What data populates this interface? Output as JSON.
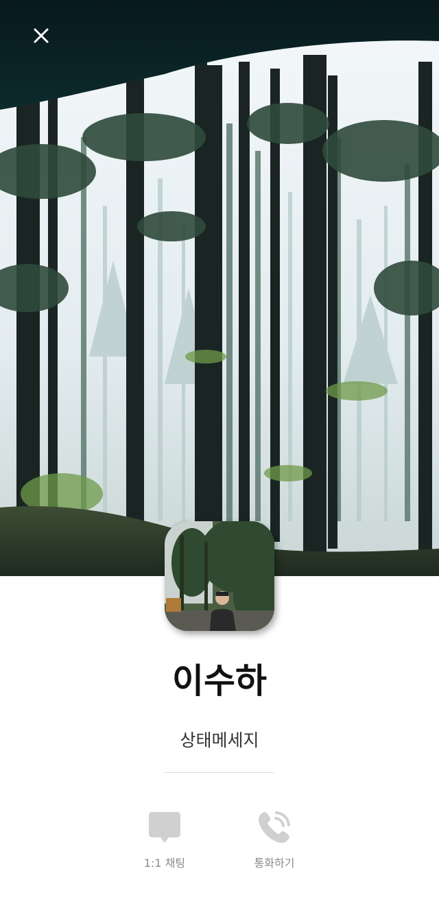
{
  "profile": {
    "name": "이수하",
    "status_message": "상태메세지"
  },
  "actions": {
    "chat_label": "1:1 채팅",
    "call_label": "통화하기"
  },
  "icons": {
    "close": "close-icon",
    "chat": "chat-bubble-icon",
    "call": "phone-call-icon"
  },
  "colors": {
    "icon_gray": "#d0d0d0",
    "label_gray": "#8a8a8a",
    "name_text": "#111111",
    "divider": "#dddddd"
  }
}
